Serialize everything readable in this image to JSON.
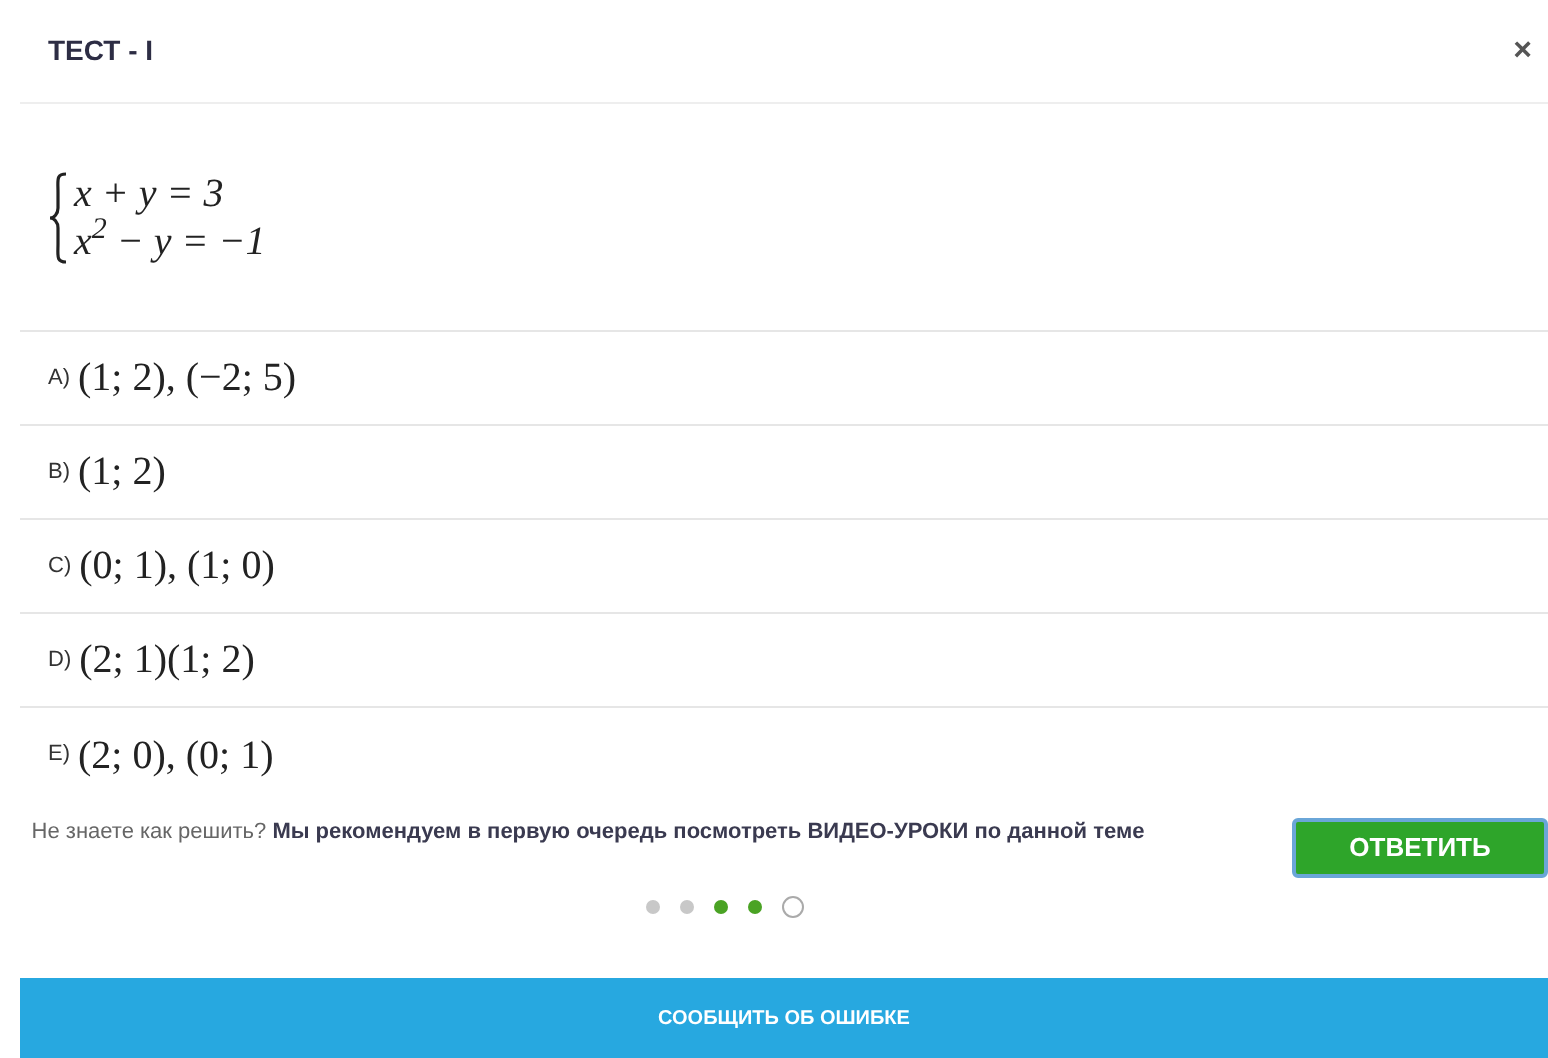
{
  "dialog": {
    "title": "ТЕСТ - I",
    "close": "×"
  },
  "equations": [
    "x + y = 3",
    "x$^{2}$ − y = −1"
  ],
  "options": [
    {
      "letter": "A)",
      "answer": "(1; 2), (−2; 5)"
    },
    {
      "letter": "B)",
      "answer": "(1; 2)"
    },
    {
      "letter": "C)",
      "answer": "(0; 1), (1; 0)"
    },
    {
      "letter": "D)",
      "answer": "(2; 1)(1; 2)"
    },
    {
      "letter": "E)",
      "answer": "(2; 0), (0; 1)"
    }
  ],
  "hint": {
    "prefix": "Не знаете как решить?",
    "text": "Мы рекомендуем в первую очередь посмотреть ВИДЕО-УРОКИ по данной теме"
  },
  "answer_button": "ОТВЕТИТЬ",
  "progress": [
    {
      "kind": "pending"
    },
    {
      "kind": "pending"
    },
    {
      "kind": "answered"
    },
    {
      "kind": "answered"
    },
    {
      "kind": "current"
    }
  ],
  "report_button": "СООБЩИТЬ ОБ ОШИБКЕ"
}
